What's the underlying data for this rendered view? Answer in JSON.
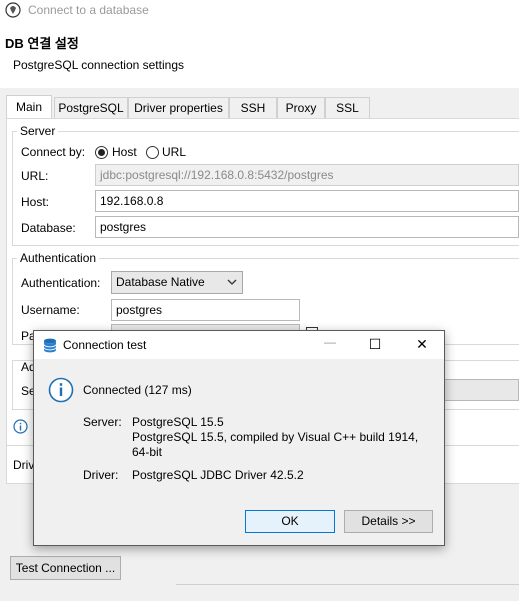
{
  "window": {
    "title": "Connect to a database"
  },
  "header": {
    "title": "DB 연결 설정",
    "subtitle": "PostgreSQL connection settings"
  },
  "tabs": [
    {
      "label": "Main"
    },
    {
      "label": "PostgreSQL"
    },
    {
      "label": "Driver properties"
    },
    {
      "label": "SSH"
    },
    {
      "label": "Proxy"
    },
    {
      "label": "SSL"
    }
  ],
  "server": {
    "legend": "Server",
    "connect_by_label": "Connect by:",
    "host_option": "Host",
    "url_option": "URL",
    "url_label": "URL:",
    "url_value": "jdbc:postgresql://192.168.0.8:5432/postgres",
    "host_label": "Host:",
    "host_value": "192.168.0.8",
    "database_label": "Database:",
    "database_value": "postgres"
  },
  "auth": {
    "legend": "Authentication",
    "auth_label": "Authentication:",
    "auth_value": "Database Native",
    "username_label": "Username:",
    "username_value": "postgres",
    "password_label_partial": "Pa"
  },
  "advanced": {
    "legend_partial": "Ad",
    "se_partial": "Se"
  },
  "driver_partial": "Driv",
  "footer": {
    "test_connection": "Test Connection ..."
  },
  "dialog": {
    "title": "Connection test",
    "status": "Connected (127 ms)",
    "server_label": "Server:",
    "server_line1": "PostgreSQL 15.5",
    "server_line2": "PostgreSQL 15.5, compiled by Visual C++ build 1914,",
    "server_line3": "64-bit",
    "driver_label": "Driver:",
    "driver_value": "PostgreSQL JDBC Driver 42.5.2",
    "ok_label": "OK",
    "details_label": "Details >>",
    "minimize_glyph": "—",
    "maximize_glyph": "☐",
    "close_glyph": "✕"
  },
  "colors": {
    "accent": "#0078d7",
    "info_icon": "#1f6fb5",
    "panel_bg": "#f0f0f0"
  }
}
